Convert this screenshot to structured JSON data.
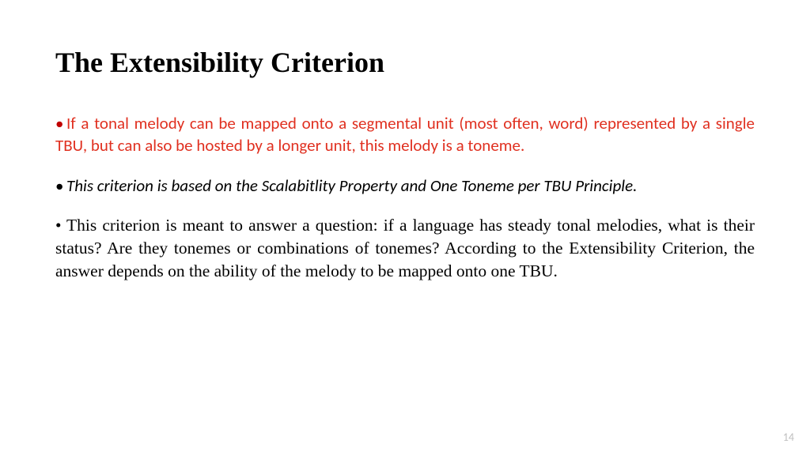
{
  "slide": {
    "title": "The Extensibility Criterion",
    "bullets": [
      "If a tonal melody can be mapped onto a segmental unit (most often, word) represented by a single TBU, but can also be hosted by a longer unit, this melody is a toneme.",
      "This criterion is based on the Scalabitlity Property and One Toneme per TBU Principle.",
      "This criterion is meant to answer a question: if a language has steady tonal melodies, what is their status? Are they tonemes or combinations of tonemes? According to the Extensibility Criterion, the answer depends on the ability of the melody to be mapped onto one TBU."
    ],
    "page_number": "14"
  }
}
